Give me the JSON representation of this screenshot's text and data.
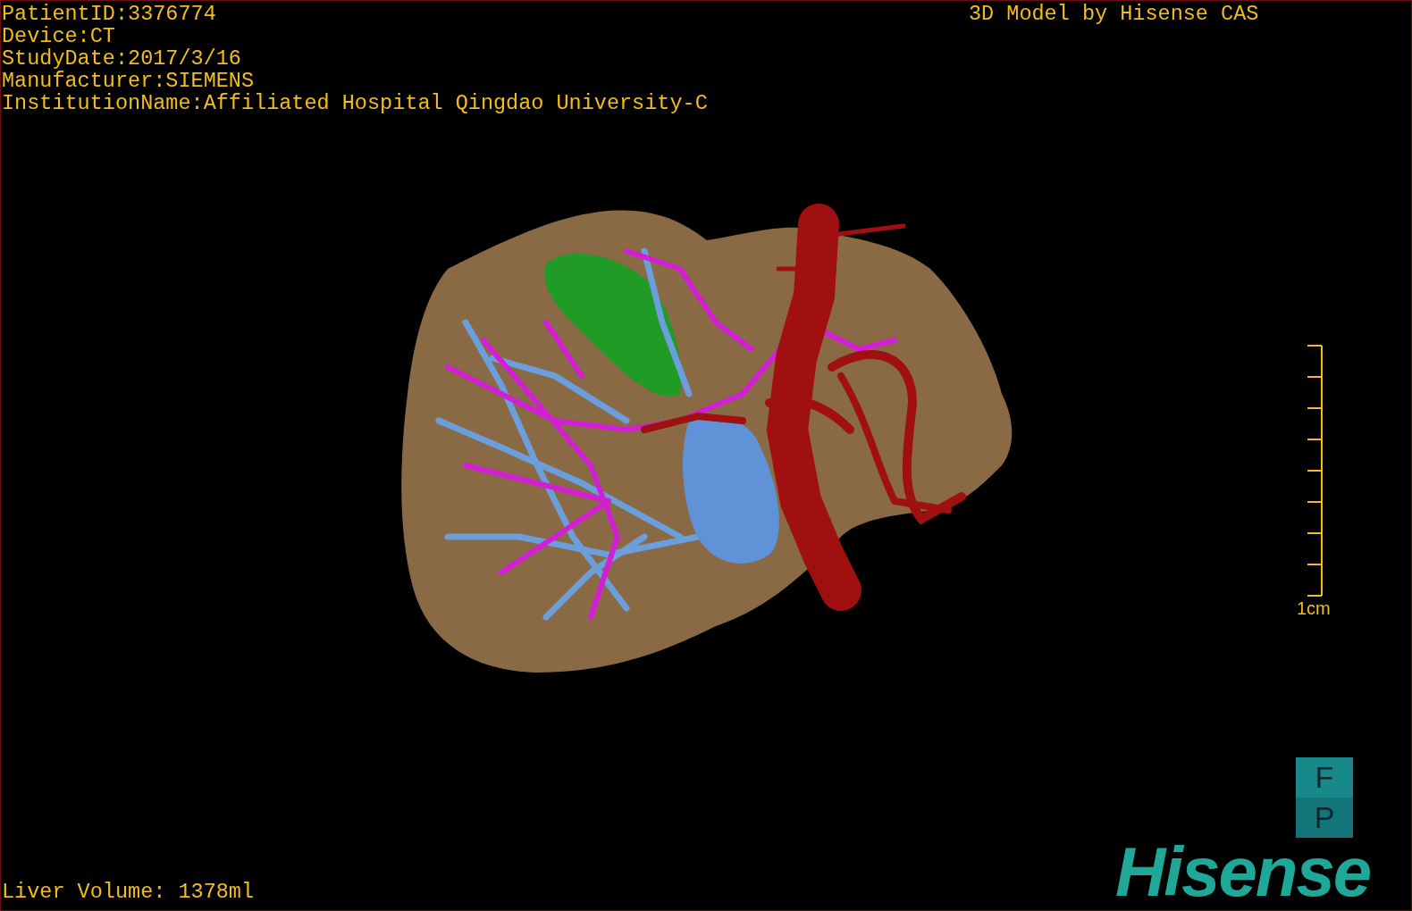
{
  "study_info": [
    "PatientID:3376774",
    "Device:CT",
    "StudyDate:2017/3/16",
    "Manufacturer:SIEMENS",
    "InstitutionName:Affiliated Hospital Qingdao University-C"
  ],
  "model_credit": "3D Model by Hisense CAS",
  "scale_bar": {
    "label": "1cm"
  },
  "liver_volume": "Liver Volume: 1378ml",
  "logo": {
    "badge_top": "F",
    "badge_bottom": "P",
    "wordmark": "Hisense"
  }
}
